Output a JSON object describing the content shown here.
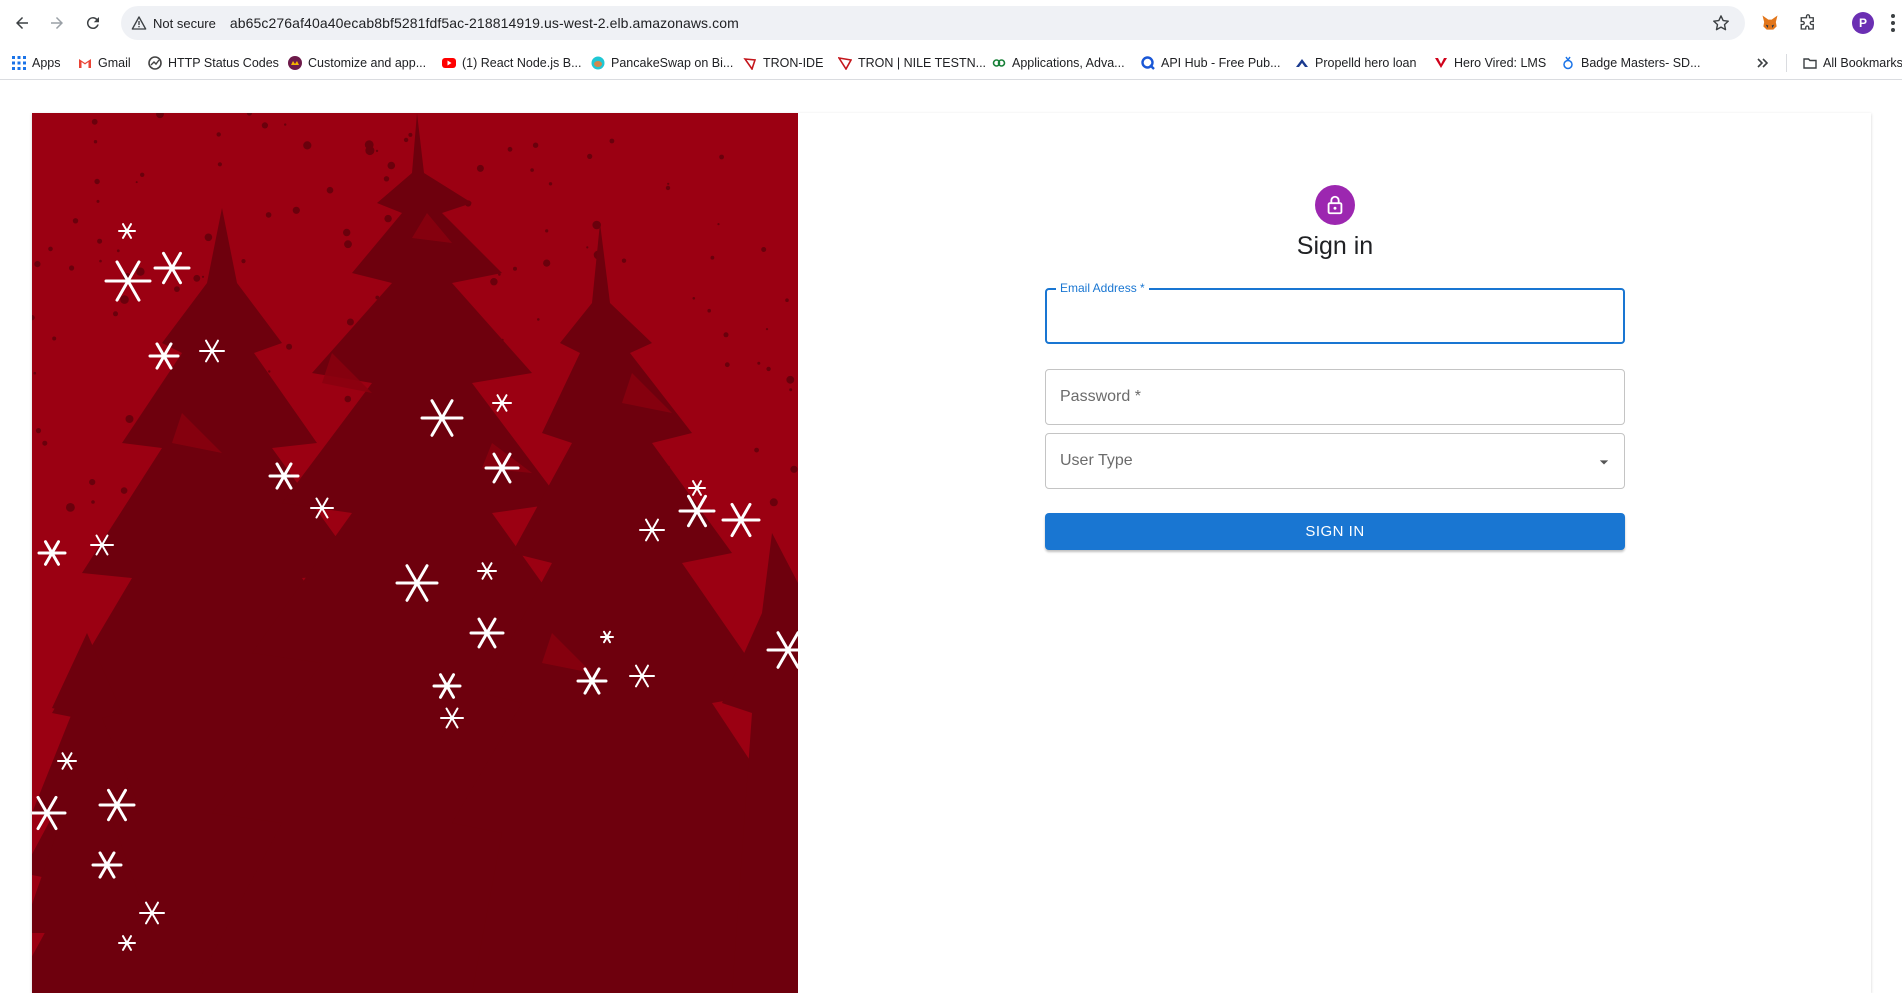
{
  "browser": {
    "security_label": "Not secure",
    "url": "ab65c276af40a40ecab8bf5281fdf5ac-218814919.us-west-2.elb.amazonaws.com",
    "profile_initial": "P"
  },
  "bookmarks": {
    "items": [
      {
        "label": "Apps",
        "icon": "apps-grid-icon"
      },
      {
        "label": "Gmail",
        "icon": "gmail-icon"
      },
      {
        "label": "HTTP Status Codes",
        "icon": "globe-icon"
      },
      {
        "label": "Customize and app...",
        "icon": "site-icon"
      },
      {
        "label": "(1) React Node.js B...",
        "icon": "youtube-icon"
      },
      {
        "label": "PancakeSwap on Bi...",
        "icon": "pancakeswap-icon"
      },
      {
        "label": "TRON-IDE",
        "icon": "tron-ide-icon"
      },
      {
        "label": "TRON | NILE TESTN...",
        "icon": "tron-icon"
      },
      {
        "label": "Applications, Adva...",
        "icon": "link-icon"
      },
      {
        "label": "API Hub - Free Pub...",
        "icon": "api-hub-icon"
      },
      {
        "label": "Propelld hero loan",
        "icon": "propelld-icon"
      },
      {
        "label": "Hero Vired: LMS",
        "icon": "hero-vired-icon"
      },
      {
        "label": "Badge Masters- SD...",
        "icon": "badge-icon"
      }
    ],
    "all_bookmarks_label": "All Bookmarks"
  },
  "signin": {
    "title": "Sign in",
    "email_label": "Email Address *",
    "email_value": "",
    "password_placeholder": "Password *",
    "user_type_placeholder": "User Type",
    "submit_label": "SIGN IN"
  },
  "colors": {
    "accent": "#1976d2",
    "lock_avatar": "#9c27b0",
    "hero_red": "#9b0012",
    "hero_dark": "#6e000d"
  }
}
